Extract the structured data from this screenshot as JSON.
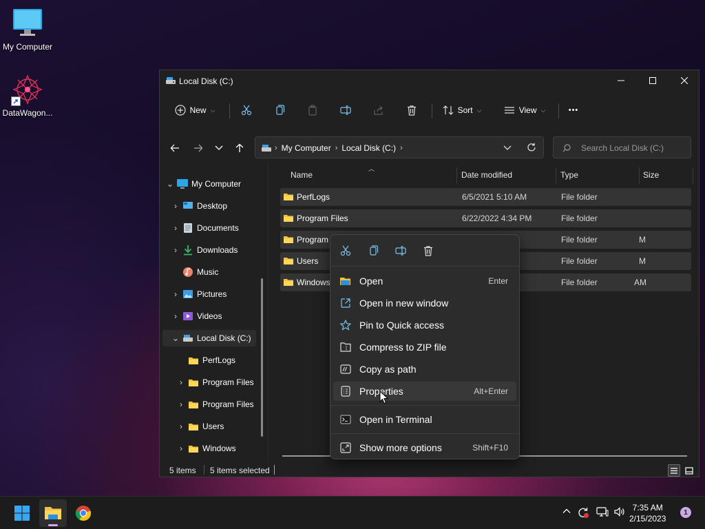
{
  "desktop": {
    "icons": [
      {
        "label": "My Computer"
      },
      {
        "label": "DataWagon..."
      }
    ]
  },
  "window": {
    "title": "Local Disk (C:)",
    "controls": {
      "minimize": "minimize",
      "maximize": "maximize",
      "close": "close"
    }
  },
  "toolbar": {
    "new_label": "New",
    "sort_label": "Sort",
    "view_label": "View",
    "more_label": "•••"
  },
  "address": {
    "crumbs": [
      "My Computer",
      "Local Disk (C:)"
    ],
    "search_placeholder": "Search Local Disk (C:)"
  },
  "nav_pane": {
    "items": [
      {
        "label": "My Computer",
        "icon": "computer-icon",
        "expanded": true,
        "level": 0
      },
      {
        "label": "Desktop",
        "icon": "desktop-icon",
        "level": 1
      },
      {
        "label": "Documents",
        "icon": "documents-icon",
        "level": 1
      },
      {
        "label": "Downloads",
        "icon": "downloads-icon",
        "level": 1
      },
      {
        "label": "Music",
        "icon": "music-icon",
        "level": 1
      },
      {
        "label": "Pictures",
        "icon": "pictures-icon",
        "level": 1
      },
      {
        "label": "Videos",
        "icon": "videos-icon",
        "level": 1
      },
      {
        "label": "Local Disk (C:)",
        "icon": "drive-icon",
        "expanded": true,
        "selected": true,
        "level": 1
      },
      {
        "label": "PerfLogs",
        "icon": "folder-icon",
        "level": 2
      },
      {
        "label": "Program Files",
        "icon": "folder-icon",
        "level": 2
      },
      {
        "label": "Program Files",
        "icon": "folder-icon",
        "level": 2
      },
      {
        "label": "Users",
        "icon": "folder-icon",
        "level": 2
      },
      {
        "label": "Windows",
        "icon": "folder-icon",
        "level": 2
      }
    ]
  },
  "columns": {
    "name": "Name",
    "date": "Date modified",
    "type": "Type",
    "size": "Size"
  },
  "files": [
    {
      "name": "PerfLogs",
      "date": "6/5/2021 5:10 AM",
      "type": "File folder"
    },
    {
      "name": "Program Files",
      "date": "6/22/2022 4:34 PM",
      "type": "File folder"
    },
    {
      "name": "Program",
      "date": "M",
      "type": "File folder"
    },
    {
      "name": "Users",
      "date": "M",
      "type": "File folder"
    },
    {
      "name": "Windows",
      "date": "AM",
      "type": "File folder"
    }
  ],
  "status": {
    "items": "5 items",
    "selected": "5 items selected"
  },
  "context_menu": {
    "items": [
      {
        "label": "Open",
        "shortcut": "Enter",
        "icon": "folder-open-icon"
      },
      {
        "label": "Open in new window",
        "shortcut": "",
        "icon": "new-window-icon"
      },
      {
        "label": "Pin to Quick access",
        "shortcut": "",
        "icon": "star-icon"
      },
      {
        "label": "Compress to ZIP file",
        "shortcut": "",
        "icon": "zip-icon"
      },
      {
        "label": "Copy as path",
        "shortcut": "",
        "icon": "copy-path-icon"
      },
      {
        "label": "Properties",
        "shortcut": "Alt+Enter",
        "icon": "properties-icon"
      },
      {
        "label": "Open in Terminal",
        "shortcut": "",
        "icon": "terminal-icon"
      },
      {
        "label": "Show more options",
        "shortcut": "Shift+F10",
        "icon": "more-options-icon"
      }
    ]
  },
  "taskbar": {
    "clock_time": "7:35 AM",
    "clock_date": "2/15/2023",
    "notification_count": "1"
  },
  "colors": {
    "accent": "#4cc2ff",
    "folder": "#f3c23e",
    "window_bg": "#202020",
    "menu_bg": "#2c2c2c"
  }
}
